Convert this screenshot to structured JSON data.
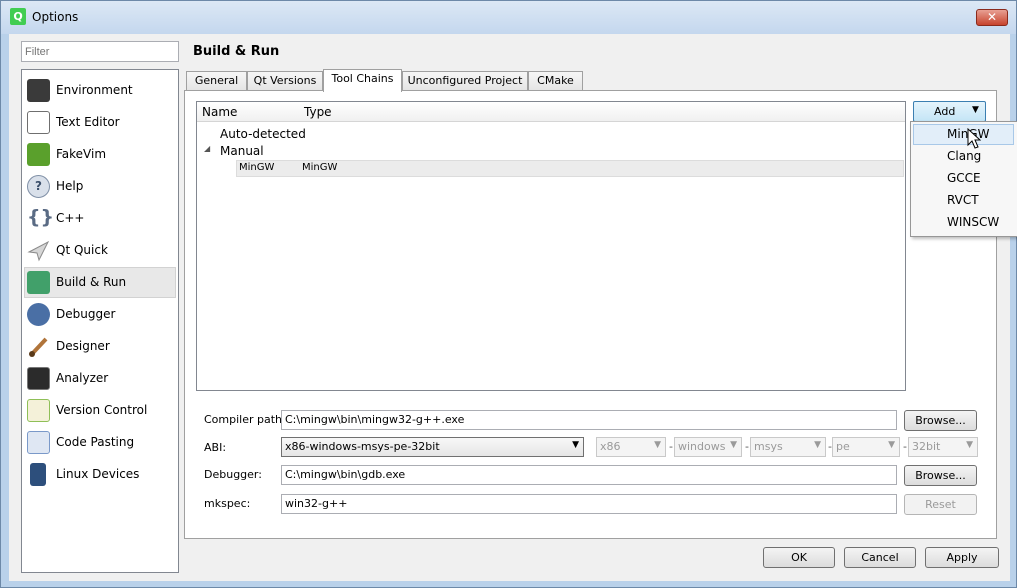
{
  "window": {
    "title": "Options",
    "app_icon": "qt-creator-icon",
    "close_icon": "close-icon"
  },
  "filter": {
    "placeholder": "Filter"
  },
  "sidebar": {
    "items": [
      {
        "label": "Environment",
        "icon": "monitor-icon",
        "color": "#3a3a3a"
      },
      {
        "label": "Text Editor",
        "icon": "text-editor-icon",
        "color": "#6f6f6f"
      },
      {
        "label": "FakeVim",
        "icon": "fakevim-icon",
        "color": "#5aa02c"
      },
      {
        "label": "Help",
        "icon": "help-icon",
        "color": "#7f8fa6"
      },
      {
        "label": "C++",
        "icon": "braces-icon",
        "color": "#5a6b84"
      },
      {
        "label": "Qt Quick",
        "icon": "paper-plane-icon",
        "color": "#9a9a9a"
      },
      {
        "label": "Build & Run",
        "icon": "build-run-icon",
        "color": "#41a06a",
        "selected": true
      },
      {
        "label": "Debugger",
        "icon": "debugger-icon",
        "color": "#4a6fa5"
      },
      {
        "label": "Designer",
        "icon": "brush-icon",
        "color": "#b0743a"
      },
      {
        "label": "Analyzer",
        "icon": "analyzer-icon",
        "color": "#2b2b2b"
      },
      {
        "label": "Version Control",
        "icon": "version-control-icon",
        "color": "#8fbf57"
      },
      {
        "label": "Code Pasting",
        "icon": "code-pasting-icon",
        "color": "#7a99c9"
      },
      {
        "label": "Linux Devices",
        "icon": "device-icon",
        "color": "#2d4f7c"
      }
    ]
  },
  "page": {
    "title": "Build & Run"
  },
  "tabs": [
    {
      "label": "General"
    },
    {
      "label": "Qt Versions"
    },
    {
      "label": "Tool Chains",
      "active": true
    },
    {
      "label": "Unconfigured Project"
    },
    {
      "label": "CMake"
    }
  ],
  "toolchains": {
    "columns": [
      "Name",
      "Type"
    ],
    "groups": [
      {
        "label": "Auto-detected",
        "children": []
      },
      {
        "label": "Manual",
        "expanded": true,
        "children": [
          {
            "name": "MinGW",
            "type": "MinGW"
          }
        ]
      }
    ]
  },
  "add_button": {
    "label": "Add"
  },
  "add_menu": {
    "items": [
      "MinGW",
      "Clang",
      "GCCE",
      "RVCT",
      "WINSCW"
    ],
    "highlighted": "MinGW"
  },
  "form": {
    "compiler_path": {
      "label": "Compiler path:",
      "value": "C:\\mingw\\bin\\mingw32-g++.exe"
    },
    "abi": {
      "label": "ABI:",
      "value": "x86-windows-msys-pe-32bit",
      "parts": [
        "x86",
        "windows",
        "msys",
        "pe",
        "32bit"
      ],
      "separator": "-"
    },
    "debugger": {
      "label": "Debugger:",
      "value": "C:\\mingw\\bin\\gdb.exe"
    },
    "mkspec": {
      "label": "mkspec:",
      "value": "win32-g++"
    },
    "browse_label": "Browse...",
    "reset_label": "Reset"
  },
  "dialog_buttons": {
    "ok": "OK",
    "cancel": "Cancel",
    "apply": "Apply"
  }
}
